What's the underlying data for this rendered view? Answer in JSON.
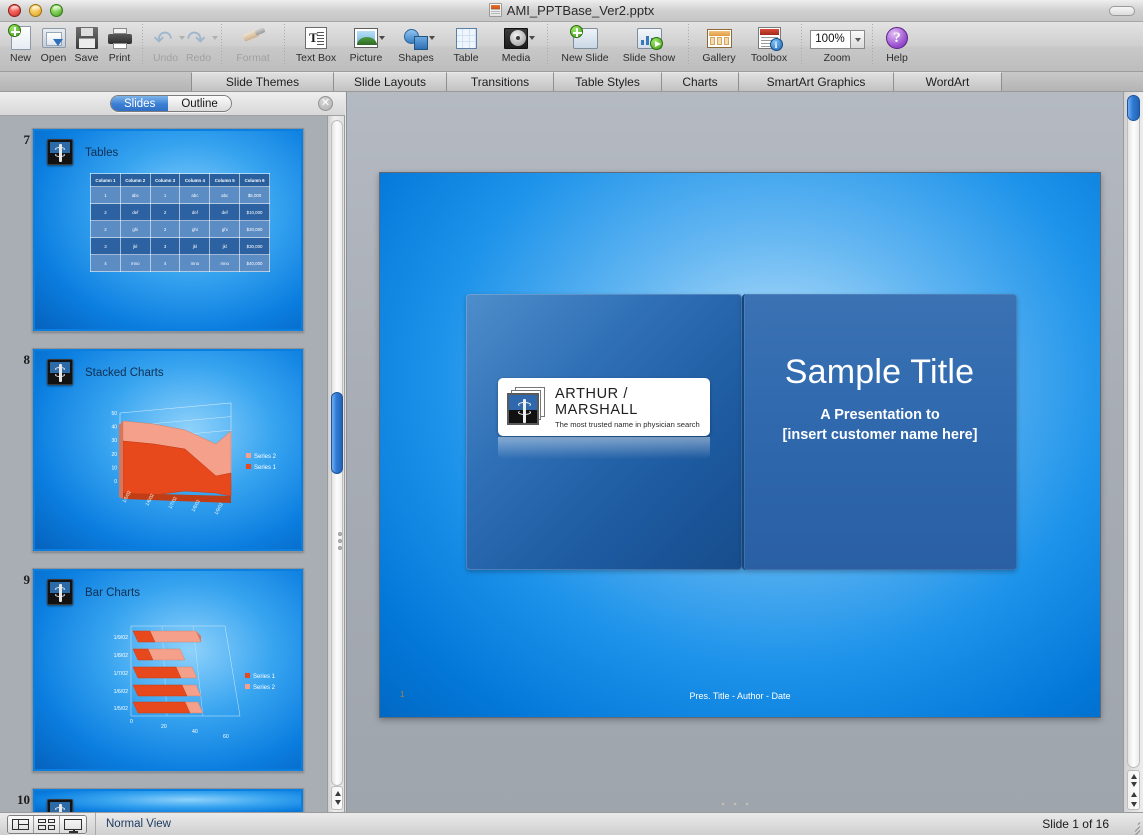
{
  "window": {
    "title": "AMI_PPTBase_Ver2.pptx",
    "doc_icon": "pptx-file-icon"
  },
  "toolbar": {
    "items": [
      {
        "label": "New",
        "icon": "new-document-icon",
        "disabled": false,
        "has_caret": false
      },
      {
        "label": "Open",
        "icon": "open-folder-icon",
        "disabled": false,
        "has_caret": false
      },
      {
        "label": "Save",
        "icon": "save-disk-icon",
        "disabled": false,
        "has_caret": false
      },
      {
        "label": "Print",
        "icon": "printer-icon",
        "disabled": false,
        "has_caret": false
      },
      {
        "label": "Undo",
        "icon": "undo-arrow-icon",
        "disabled": true,
        "has_caret": true
      },
      {
        "label": "Redo",
        "icon": "redo-arrow-icon",
        "disabled": true,
        "has_caret": true
      },
      {
        "label": "Format",
        "icon": "format-brush-icon",
        "disabled": true,
        "has_caret": false
      },
      {
        "label": "Text Box",
        "icon": "text-box-icon",
        "disabled": false,
        "has_caret": false
      },
      {
        "label": "Picture",
        "icon": "picture-icon",
        "disabled": false,
        "has_caret": true
      },
      {
        "label": "Shapes",
        "icon": "shapes-icon",
        "disabled": false,
        "has_caret": true
      },
      {
        "label": "Table",
        "icon": "table-grid-icon",
        "disabled": false,
        "has_caret": false
      },
      {
        "label": "Media",
        "icon": "media-disc-icon",
        "disabled": false,
        "has_caret": true
      },
      {
        "label": "New Slide",
        "icon": "new-slide-icon",
        "disabled": false,
        "has_caret": false
      },
      {
        "label": "Slide Show",
        "icon": "slide-show-icon",
        "disabled": false,
        "has_caret": false
      },
      {
        "label": "Gallery",
        "icon": "gallery-icon",
        "disabled": false,
        "has_caret": false
      },
      {
        "label": "Toolbox",
        "icon": "toolbox-icon",
        "disabled": false,
        "has_caret": false
      }
    ],
    "zoom": {
      "label": "Zoom",
      "value": "100%",
      "stepper_icon": "chevron-down-icon"
    },
    "help": {
      "label": "Help",
      "icon": "help-question-icon"
    }
  },
  "ribbon": {
    "tabs": [
      {
        "label": "Slide Themes"
      },
      {
        "label": "Slide Layouts"
      },
      {
        "label": "Transitions"
      },
      {
        "label": "Table Styles"
      },
      {
        "label": "Charts"
      },
      {
        "label": "SmartArt Graphics"
      },
      {
        "label": "WordArt"
      }
    ]
  },
  "left_pane": {
    "segmented": {
      "slides_label": "Slides",
      "outline_label": "Outline",
      "selected": "Slides"
    },
    "close_icon": "close-icon",
    "thumbnails": [
      {
        "number": "7",
        "title": "Tables",
        "badge_icon": "arthur-marshall-logo-icon",
        "table": {
          "headers": [
            "Column 1",
            "Column 2",
            "Column 3",
            "Column 4",
            "Column 5",
            "Column 6"
          ],
          "rows": [
            [
              "1",
              "abc",
              "1",
              "abc",
              "abc",
              "$5,000"
            ],
            [
              "2",
              "def",
              "2",
              "def",
              "def",
              "$10,000"
            ],
            [
              "2",
              "ghi",
              "2",
              "ghi",
              "ghi",
              "$20,000"
            ],
            [
              "3",
              "jkl",
              "3",
              "jkl",
              "jkl",
              "$30,000"
            ],
            [
              "4",
              "mno",
              "4",
              "mno",
              "mno",
              "$40,000"
            ]
          ]
        }
      },
      {
        "number": "8",
        "title": "Stacked Charts",
        "badge_icon": "arthur-marshall-logo-icon",
        "chart_ref": 0
      },
      {
        "number": "9",
        "title": "Bar Charts",
        "badge_icon": "arthur-marshall-logo-icon",
        "chart_ref": 1
      },
      {
        "number": "10",
        "title": "",
        "badge_icon": "arthur-marshall-logo-icon"
      }
    ]
  },
  "slide": {
    "logo": {
      "name": "ARTHUR / MARSHALL",
      "tagline": "The most trusted name in physician search",
      "mark_icon": "rod-of-asclepius-icon"
    },
    "title": "Sample Title",
    "subtitle_line1": "A Presentation to",
    "subtitle_line2": "[insert customer name here]",
    "footer_number": "1",
    "footer_text": "Pres. Title - Author - Date"
  },
  "status_bar": {
    "view_buttons": [
      {
        "name": "normal-view-button",
        "icon": "normal-view-icon",
        "active": true
      },
      {
        "name": "slide-sorter-button",
        "icon": "slide-sorter-icon",
        "active": false
      },
      {
        "name": "presenter-view-button",
        "icon": "presenter-view-icon",
        "active": false
      }
    ],
    "view_label": "Normal View",
    "slide_counter": "Slide 1 of 16"
  },
  "colors": {
    "accent_blue": "#2f79d4",
    "slide_blue": "#0b7ee0",
    "panel_blue": "#2f68ad",
    "chart_series1": "#e8491c",
    "chart_series2": "#f4a08a",
    "selection_blue": "#3b7fd4"
  },
  "chart_data": [
    {
      "type": "area",
      "title": "Stacked Charts",
      "stacked": true,
      "categories": [
        "1/5/02",
        "1/6/02",
        "1/7/02",
        "1/8/02",
        "1/9/02"
      ],
      "series": [
        {
          "name": "Series 1",
          "color": "#e8491c",
          "values": [
            32,
            30,
            26,
            8,
            9
          ]
        },
        {
          "name": "Series 2",
          "color": "#f4a08a",
          "values": [
            13,
            14,
            14,
            22,
            31
          ]
        }
      ],
      "ylabel": "",
      "xlabel": "",
      "ylim": [
        0,
        50
      ],
      "yticks": [
        0,
        10,
        20,
        30,
        40,
        50
      ],
      "legend": "right",
      "grid": true
    },
    {
      "type": "bar",
      "title": "Bar Charts",
      "orientation": "horizontal",
      "stacked": true,
      "categories": [
        "1/5/02",
        "1/6/02",
        "1/7/02",
        "1/8/02",
        "1/9/02"
      ],
      "series": [
        {
          "name": "Series 1",
          "color": "#e8491c",
          "values": [
            32,
            30,
            26,
            8,
            9
          ]
        },
        {
          "name": "Series 2",
          "color": "#f4a08a",
          "values": [
            13,
            14,
            14,
            22,
            31
          ]
        }
      ],
      "xlim": [
        0,
        60
      ],
      "xticks": [
        0,
        20,
        40,
        60
      ],
      "legend": "right",
      "grid": true
    }
  ]
}
